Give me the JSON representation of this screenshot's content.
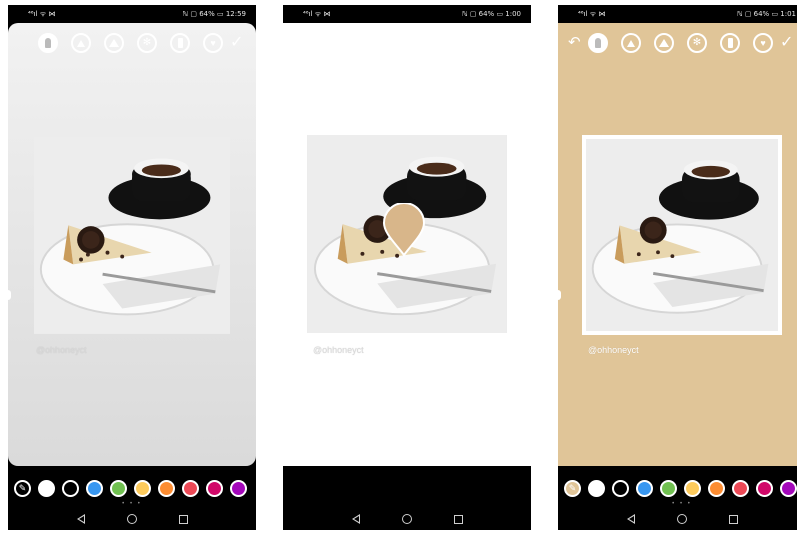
{
  "screens": [
    {
      "id": "left",
      "status_left": "⁴⁶ıl ᯤ ⋈",
      "status_right": "ℕ ▢ 64% ▭ 12:59",
      "watermark": "@ohhoneyct",
      "selected_tool": "marker",
      "background_color": "#e3e3e3",
      "picker_active": false,
      "icons": [
        "pen-tip-icon",
        "arrow-up-icon",
        "marker-icon",
        "neon-icon",
        "eraser-icon",
        "heart-icon",
        "check-icon"
      ]
    },
    {
      "id": "middle",
      "status_left": "⁴⁶ıl ᯤ ⋈",
      "status_right": "ℕ ▢ 64% ▭ 1:00",
      "watermark": "@ohhoneyct",
      "drop_color": "#d8b68a",
      "background_color": "#ffffff"
    },
    {
      "id": "right",
      "status_left": "⁴⁶ıl ᯤ ⋈",
      "status_right": "ℕ ▢ 64% ▭ 1:01",
      "watermark": "@ohhoneyct",
      "selected_tool": "marker",
      "background_color": "#e0c598",
      "picker_active": true
    }
  ],
  "palette": [
    "#ffffff",
    "#000000",
    "#3897f0",
    "#70c050",
    "#fdcb5c",
    "#fd8d32",
    "#ed4956",
    "#d10869",
    "#a307ba"
  ],
  "nav": {
    "back": "◁",
    "home": "○",
    "recent": "□"
  },
  "page_dots": "• • •"
}
